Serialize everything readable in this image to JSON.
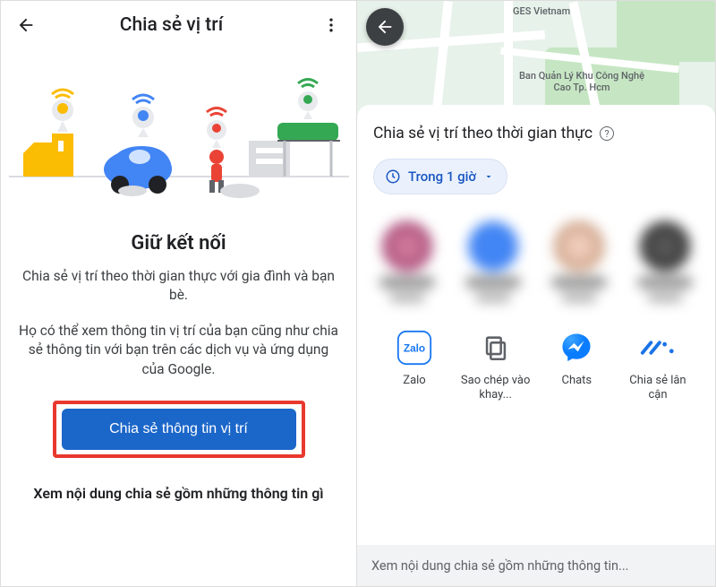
{
  "left": {
    "header_title": "Chia sẻ vị trí",
    "heading": "Giữ kết nối",
    "desc1": "Chia sẻ vị trí theo thời gian thực với gia đình và bạn bè.",
    "desc2": "Họ có thể xem thông tin vị trí của bạn cũng như chia sẻ thông tin với bạn trên các dịch vụ và ứng dụng của Google.",
    "cta": "Chia sẻ thông tin vị trí",
    "footer": "Xem nội dung chia sẻ gồm những thông tin gì"
  },
  "right": {
    "map_labels": {
      "poi1": "GES Vietnam",
      "poi2": "Ban Quản Lý Khu Công Nghệ Cao Tp. Hcm"
    },
    "sheet_title": "Chia sẻ vị trí theo thời gian thực",
    "chip": "Trong 1 giờ",
    "share_apps": [
      {
        "label": "Zalo"
      },
      {
        "label": "Sao chép vào khay..."
      },
      {
        "label": "Chats"
      },
      {
        "label": "Chia sẻ lân cận"
      }
    ],
    "footer": "Xem nội dung chia sẻ gồm những thông tin..."
  }
}
